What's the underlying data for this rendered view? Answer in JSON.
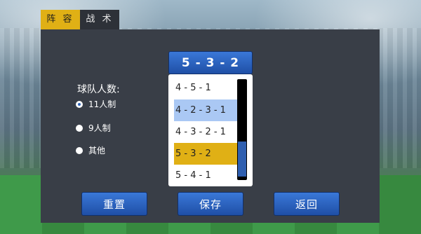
{
  "tabs": [
    {
      "label": "阵 容",
      "active": true
    },
    {
      "label": "战 术",
      "active": false
    }
  ],
  "team_size": {
    "label": "球队人数:",
    "options": [
      {
        "label": "11人制",
        "selected": true
      },
      {
        "label": "9人制",
        "selected": false
      },
      {
        "label": "其他",
        "selected": false
      }
    ]
  },
  "formation": {
    "selected": "5 - 3 - 2",
    "options": [
      {
        "label": "4 - 5 - 1",
        "state": "normal"
      },
      {
        "label": "4 - 2 - 3 - 1",
        "state": "highlighted"
      },
      {
        "label": "4 - 3 - 2 - 1",
        "state": "normal"
      },
      {
        "label": "5 - 3 - 2",
        "state": "selected"
      },
      {
        "label": "5 - 4 - 1",
        "state": "normal"
      }
    ]
  },
  "buttons": {
    "reset": "重置",
    "save": "保存",
    "back": "返回"
  },
  "colors": {
    "accent": "#e0b015",
    "button_blue": "#2f64b8",
    "panel": "#393e47",
    "highlight": "#aac8f4"
  }
}
